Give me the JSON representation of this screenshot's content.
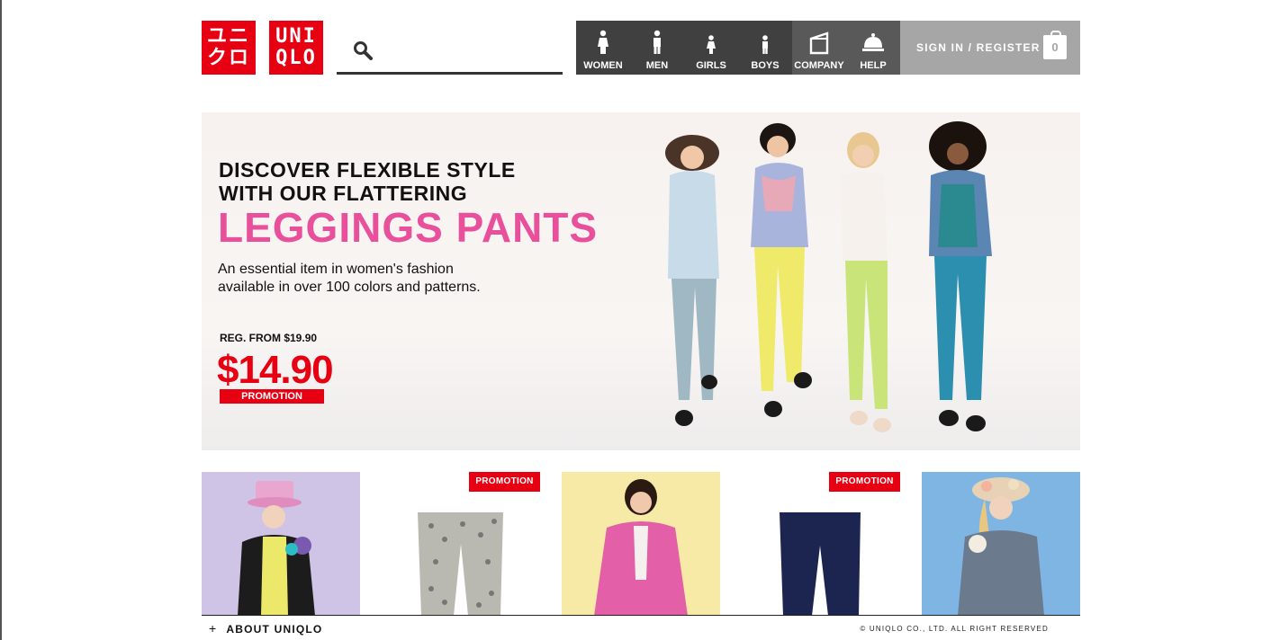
{
  "header": {
    "logo_kana": "ユニ\nクロ",
    "logo_latin": "UNI\nQLO",
    "search": {
      "placeholder": "",
      "value": ""
    },
    "nav": [
      {
        "label": "WOMEN",
        "icon": "woman-icon"
      },
      {
        "label": "MEN",
        "icon": "man-icon"
      },
      {
        "label": "GIRLS",
        "icon": "girl-icon"
      },
      {
        "label": "BOYS",
        "icon": "boy-icon"
      },
      {
        "label": "COMPANY",
        "icon": "company-icon"
      },
      {
        "label": "HELP",
        "icon": "help-bell-icon"
      }
    ],
    "signin_label": "SIGN IN / REGISTER",
    "cart_count": "0"
  },
  "hero": {
    "line1": "DISCOVER FLEXIBLE STYLE",
    "line2": "WITH OUR FLATTERING",
    "headline": "LEGGINGS PANTS",
    "description_1": "An essential item in women's fashion",
    "description_2": "available in over 100 colors and patterns.",
    "reg_price": "REG. FROM $19.90",
    "price": "$14.90",
    "promo": "PROMOTION"
  },
  "products": {
    "badge_1": "PROMOTION",
    "badge_2": "PROMOTION"
  },
  "footer": {
    "about": "ABOUT UNIQLO",
    "copyright": "© UNIQLO CO., LTD. ALL RIGHT RESERVED"
  },
  "colors": {
    "brand_red": "#e60012",
    "headline_pink": "#e8509b",
    "nav_dark": "#404040",
    "nav_mid": "#595959",
    "signin_gray": "#a6a6a6"
  }
}
